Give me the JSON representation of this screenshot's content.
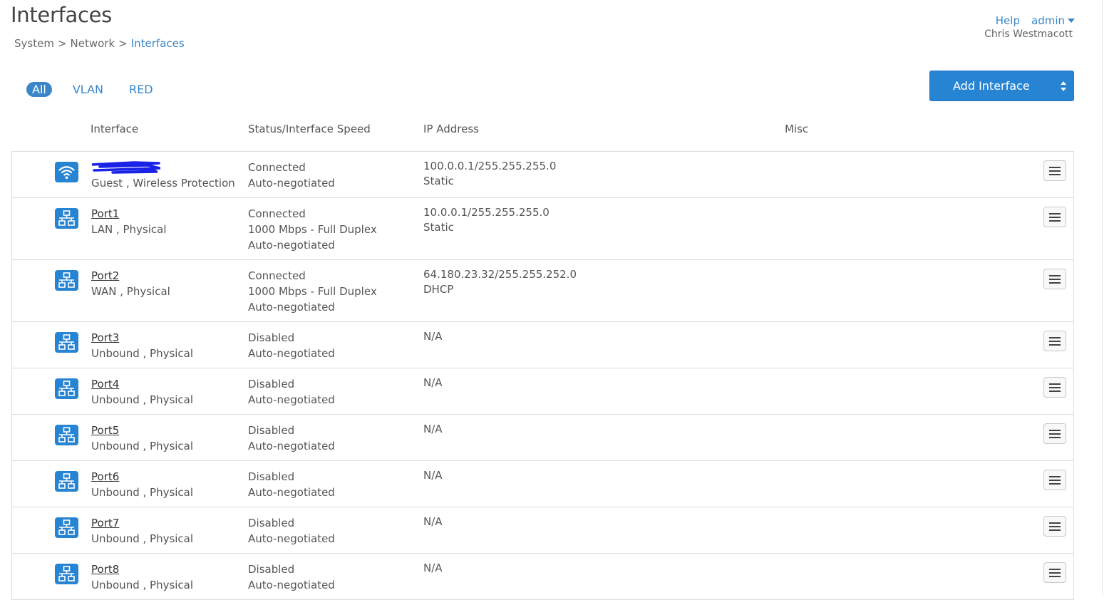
{
  "page": {
    "title": "Interfaces",
    "breadcrumb": [
      "System",
      "Network",
      "Interfaces"
    ],
    "breadcrumb_sep": ">"
  },
  "top_right": {
    "help": "Help",
    "user_menu": "admin",
    "user_name": "Chris Westmacott"
  },
  "filters": [
    {
      "label": "All",
      "active": true
    },
    {
      "label": "VLAN",
      "active": false
    },
    {
      "label": "RED",
      "active": false
    }
  ],
  "add_button": {
    "label": "Add Interface"
  },
  "columns": [
    "Interface",
    "Status/Interface Speed",
    "IP Address",
    "Misc"
  ],
  "colors": {
    "accent": "#2784d3",
    "link": "#3a86c8",
    "icon": "#2784d3"
  },
  "rows": [
    {
      "icon": "wifi-icon",
      "name": "",
      "redacted": true,
      "detail": "Guest , Wireless Protection",
      "status": [
        "Connected",
        "Auto-negotiated"
      ],
      "ip": [
        "100.0.0.1/255.255.255.0",
        "Static"
      ]
    },
    {
      "icon": "network-icon",
      "name": "Port1",
      "detail": "LAN , Physical",
      "status": [
        "Connected",
        "1000 Mbps - Full Duplex",
        "Auto-negotiated"
      ],
      "ip": [
        "10.0.0.1/255.255.255.0",
        "Static"
      ]
    },
    {
      "icon": "network-icon",
      "name": "Port2",
      "detail": "WAN , Physical",
      "status": [
        "Connected",
        "1000 Mbps - Full Duplex",
        "Auto-negotiated"
      ],
      "ip": [
        "64.180.23.32/255.255.252.0",
        "DHCP"
      ]
    },
    {
      "icon": "network-icon",
      "name": "Port3",
      "detail": "Unbound , Physical",
      "status": [
        "Disabled",
        "Auto-negotiated"
      ],
      "ip": [
        "N/A"
      ]
    },
    {
      "icon": "network-icon",
      "name": "Port4",
      "detail": "Unbound , Physical",
      "status": [
        "Disabled",
        "Auto-negotiated"
      ],
      "ip": [
        "N/A"
      ]
    },
    {
      "icon": "network-icon",
      "name": "Port5",
      "detail": "Unbound , Physical",
      "status": [
        "Disabled",
        "Auto-negotiated"
      ],
      "ip": [
        "N/A"
      ]
    },
    {
      "icon": "network-icon",
      "name": "Port6",
      "detail": "Unbound , Physical",
      "status": [
        "Disabled",
        "Auto-negotiated"
      ],
      "ip": [
        "N/A"
      ]
    },
    {
      "icon": "network-icon",
      "name": "Port7",
      "detail": "Unbound , Physical",
      "status": [
        "Disabled",
        "Auto-negotiated"
      ],
      "ip": [
        "N/A"
      ]
    },
    {
      "icon": "network-icon",
      "name": "Port8",
      "detail": "Unbound , Physical",
      "status": [
        "Disabled",
        "Auto-negotiated"
      ],
      "ip": [
        "N/A"
      ]
    }
  ]
}
